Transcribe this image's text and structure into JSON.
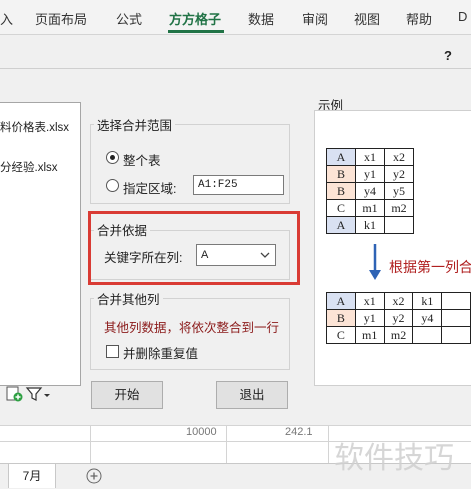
{
  "ribbon": {
    "tabs": [
      {
        "label": "入"
      },
      {
        "label": "页面布局"
      },
      {
        "label": "公式"
      },
      {
        "label": "方方格子"
      },
      {
        "label": "数据"
      },
      {
        "label": "审阅"
      },
      {
        "label": "视图"
      },
      {
        "label": "帮助"
      },
      {
        "label": "D"
      }
    ]
  },
  "dialog": {
    "help": "?",
    "files": [
      "料价格表.xlsx",
      "分经验.xlsx"
    ],
    "range_group": {
      "title": "选择合并范围",
      "whole_table": "整个表",
      "specified_range": "指定区域:",
      "range_value": "A1:F25"
    },
    "basis_group": {
      "title": "合并依据",
      "key_column_label": "关键字所在列:",
      "key_column_value": "A"
    },
    "other_group": {
      "title": "合并其他列",
      "note": "其他列数据，将依次整合到一行",
      "dedupe_label": "并删除重复值"
    },
    "buttons": {
      "start": "开始",
      "exit": "退出"
    },
    "example": {
      "title": "示例",
      "arrow_text": "根据第一列合",
      "before_table": [
        [
          "A",
          "x1",
          "x2"
        ],
        [
          "B",
          "y1",
          "y2"
        ],
        [
          "B",
          "y4",
          "y5"
        ],
        [
          "C",
          "m1",
          "m2"
        ],
        [
          "A",
          "k1",
          ""
        ]
      ],
      "after_table": [
        [
          "A",
          "x1",
          "x2",
          "k1",
          ""
        ],
        [
          "B",
          "y1",
          "y2",
          "y4",
          ""
        ],
        [
          "C",
          "m1",
          "m2",
          "",
          ""
        ]
      ]
    }
  },
  "sheet": {
    "cells": [
      "10000",
      "242.1"
    ],
    "tabs": [
      "7月"
    ],
    "add_sheet": "+"
  },
  "watermark": "软件技巧",
  "colors": {
    "accent": "#217346",
    "highlight": "#d93b34",
    "label_dark_red": "#8b1a1a",
    "arrow": "#2e63b5"
  }
}
